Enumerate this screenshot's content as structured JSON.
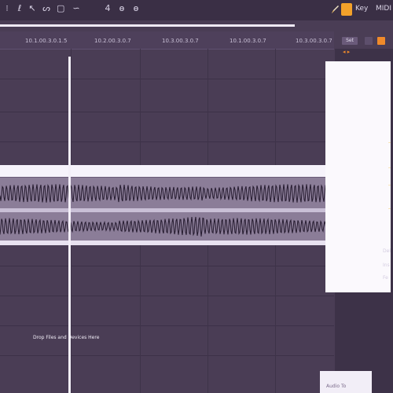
{
  "toolbar": {
    "tools": [
      {
        "icon": "pointer-icon",
        "glyph": "⁝"
      },
      {
        "icon": "draw-icon",
        "glyph": "ℓ"
      },
      {
        "icon": "select-icon",
        "glyph": "↖"
      },
      {
        "icon": "curve-icon",
        "glyph": "ᔕ"
      },
      {
        "icon": "box-icon",
        "glyph": "▢"
      },
      {
        "icon": "tilde-icon",
        "glyph": "∽"
      },
      {
        "icon": "number-icon",
        "glyph": "4"
      },
      {
        "icon": "zoom-icon",
        "glyph": "ɵ"
      },
      {
        "icon": "loop-icon",
        "glyph": "ɵ"
      }
    ],
    "key_label": "Key",
    "midi_label": "MIDI",
    "accent": "#f3a12a"
  },
  "ruler": {
    "labels": [
      "10.1.00.3.0.1.5",
      "10.2.00.3.0.7",
      "10.3.00.3.0.7",
      "10.1.00.3.0.7",
      "10.3.00.3.0.7"
    ]
  },
  "right_header": {
    "set_label": "Set"
  },
  "drop_zone": {
    "text": "Drop Files and Devices Here"
  },
  "side": {
    "marks": [
      "–",
      "–",
      "–",
      "–"
    ],
    "labels": [
      "Del",
      "Ins",
      "Fe"
    ]
  },
  "bottom_box": {
    "label": "Audio To"
  },
  "colors": {
    "background": "#4a3d55",
    "clip_header": "#f6f3fb",
    "waveform": "#241a2e"
  }
}
